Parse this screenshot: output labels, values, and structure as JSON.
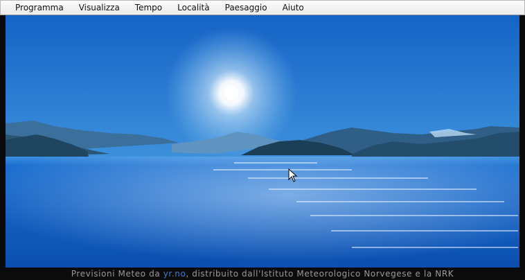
{
  "menu": {
    "items": [
      "Programma",
      "Visualizza",
      "Tempo",
      "Località",
      "Paesaggio",
      "Aiuto"
    ]
  },
  "footer": {
    "prefix": "Previsioni Meteo da ",
    "link": "yr.no",
    "suffix": ", distribuito dall'Istituto Meteorologico Norvegese e la NRK"
  },
  "colors": {
    "sky_top": "#1667c9",
    "sky_bottom": "#7ec3ec",
    "sea": "#0f5fc4",
    "hills": "#1e4a66"
  }
}
